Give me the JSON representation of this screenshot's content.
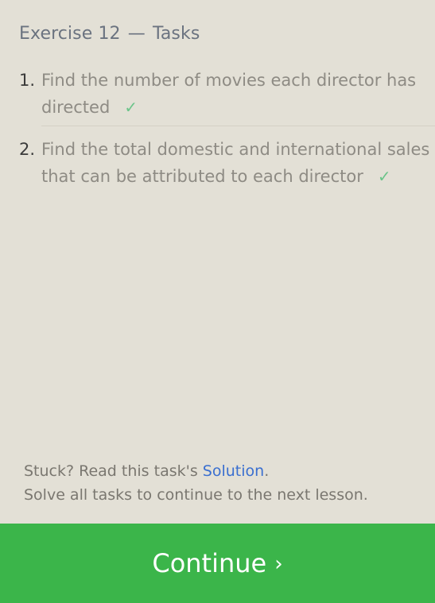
{
  "header": {
    "exercise": "Exercise 12",
    "separator": "—",
    "section": "Tasks"
  },
  "tasks": [
    {
      "number": "1.",
      "text": "Find the number of movies each director has directed",
      "check": "✓"
    },
    {
      "number": "2.",
      "text": "Find the total domestic and international sales that can be attributed to each director",
      "check": "✓"
    }
  ],
  "footer": {
    "stuck_prefix": "Stuck? Read this task's ",
    "solution_link": "Solution",
    "stuck_suffix": ".",
    "instruction": "Solve all tasks to continue to the next lesson."
  },
  "continue_button": {
    "label": "Continue",
    "chevron": "›"
  },
  "colors": {
    "background": "#e3e0d6",
    "button": "#3bb54a",
    "check": "#6cc48a",
    "link": "#3a6fd0"
  }
}
